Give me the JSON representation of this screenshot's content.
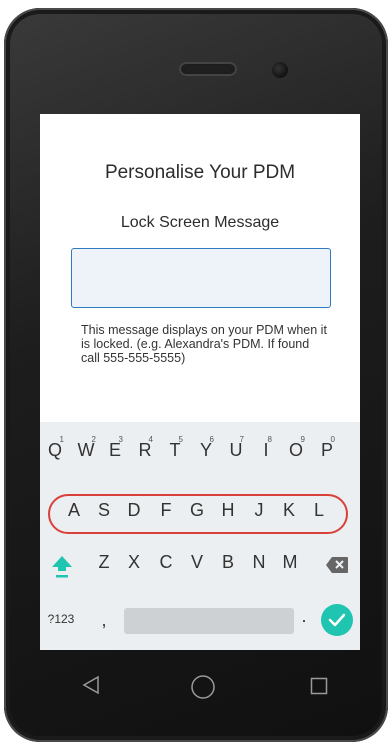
{
  "screen": {
    "title": "Personalise Your PDM",
    "section_label": "Lock Screen Message",
    "input_value": "",
    "help_text": "This message displays on your PDM when it is locked. (e.g. Alexandra's PDM. If found call 555-555-5555)"
  },
  "keyboard": {
    "row1": [
      {
        "key": "Q",
        "hint": "1"
      },
      {
        "key": "W",
        "hint": "2"
      },
      {
        "key": "E",
        "hint": "3"
      },
      {
        "key": "R",
        "hint": "4"
      },
      {
        "key": "T",
        "hint": "5"
      },
      {
        "key": "Y",
        "hint": "6"
      },
      {
        "key": "U",
        "hint": "7"
      },
      {
        "key": "I",
        "hint": "8"
      },
      {
        "key": "O",
        "hint": "9"
      },
      {
        "key": "P",
        "hint": "0"
      }
    ],
    "row2": [
      "A",
      "S",
      "D",
      "F",
      "G",
      "H",
      "J",
      "K",
      "L"
    ],
    "row3": [
      "Z",
      "X",
      "C",
      "V",
      "B",
      "N",
      "M"
    ],
    "symbols_label": "?123",
    "comma_label": ",",
    "period_label": ".",
    "accent_color": "#1fc5b1",
    "highlight_color": "#d9403a"
  },
  "icons": {
    "shift": "shift-up-arrow",
    "backspace": "backspace",
    "done": "checkmark",
    "nav_back": "triangle-left",
    "nav_home": "circle",
    "nav_recents": "square"
  }
}
